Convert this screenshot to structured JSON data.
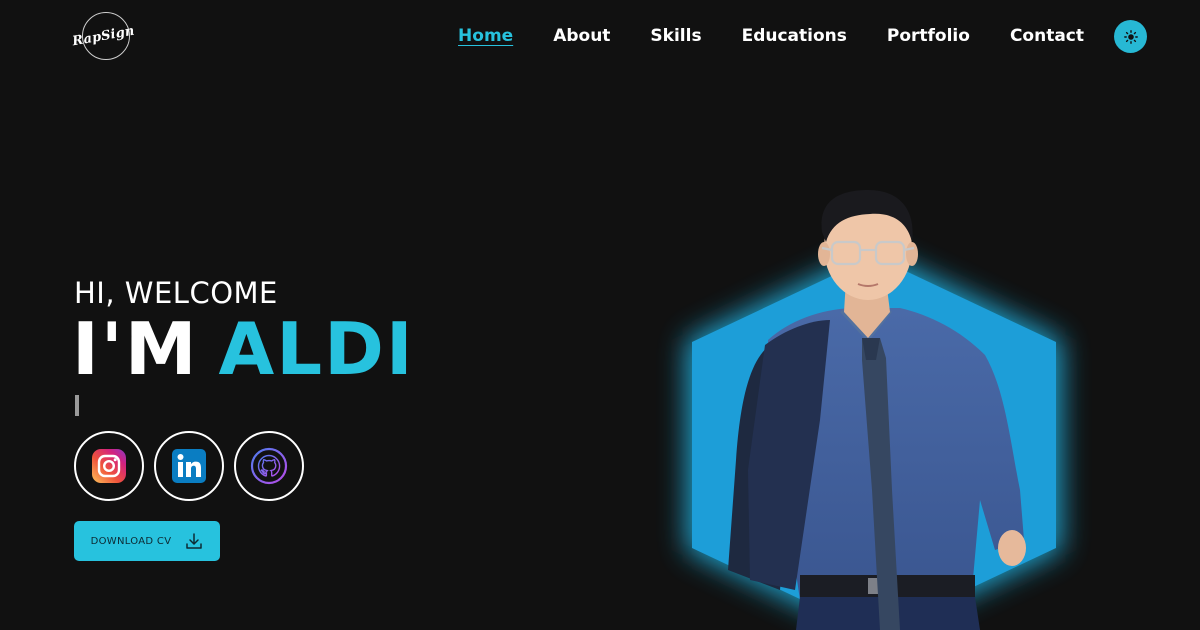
{
  "header": {
    "logo_text": "RapSign",
    "nav": [
      {
        "label": "Home",
        "active": true
      },
      {
        "label": "About"
      },
      {
        "label": "Skills"
      },
      {
        "label": "Educations"
      },
      {
        "label": "Portfolio"
      },
      {
        "label": "Contact"
      }
    ],
    "theme_toggle_icon": "sun-icon"
  },
  "hero": {
    "greeting": "HI, WELCOME",
    "headline_prefix": "I'M",
    "headline_name": "ALDI",
    "socials": [
      {
        "name": "instagram",
        "icon": "instagram-icon"
      },
      {
        "name": "linkedin",
        "icon": "linkedin-icon"
      },
      {
        "name": "github",
        "icon": "github-icon"
      }
    ],
    "download_label": "DOWNLOAD CV",
    "download_icon": "download-icon"
  },
  "colors": {
    "background": "#111111",
    "accent": "#27c2de",
    "hexagon": "#1d9ed8",
    "text": "#ffffff"
  }
}
